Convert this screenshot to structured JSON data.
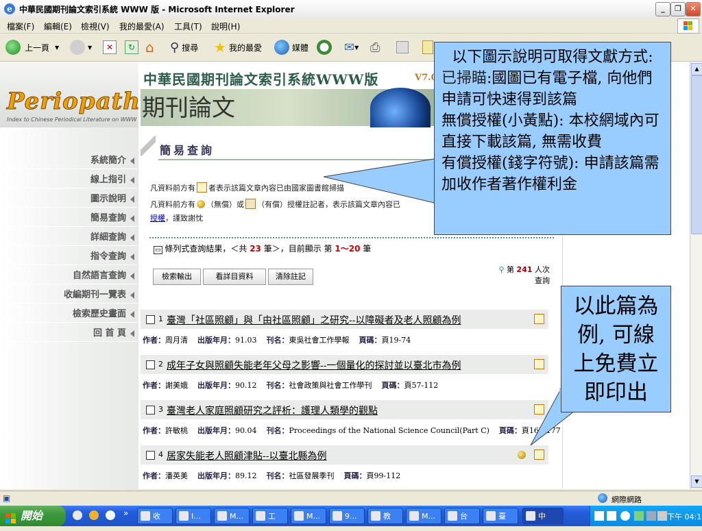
{
  "window": {
    "title": "中華民國期刊論文索引系統 WWW 版 - Microsoft Internet Explorer"
  },
  "menu": [
    "檔案(F)",
    "編輯(E)",
    "檢視(V)",
    "我的最愛(A)",
    "工具(T)",
    "說明(H)"
  ],
  "toolbar": {
    "back": "上一頁",
    "search": "搜尋",
    "favorites": "我的最愛",
    "media": "媒體"
  },
  "sidebar": {
    "logo": "Periopath",
    "logo_sub": "Index to Chinese Periodical Literature on WWW",
    "items": [
      "系統簡介",
      "線上指引",
      "圖示說明",
      "簡易查詢",
      "詳細查詢",
      "指令查詢",
      "自然語言查詢",
      "收編期刊一覽表",
      "檢索歷史畫面",
      "回 首 頁"
    ]
  },
  "banner": {
    "title": "中華民國期刊論文索引系統WWW版",
    "version": "V7.0",
    "calligraphy": "期刊論文"
  },
  "section": {
    "title": "簡易查詢"
  },
  "notes": {
    "line1_a": "凡資料前方有",
    "line1_b": "者表示該篇文章內容已由國家圖書館掃描",
    "line2_a": "凡資料前方有",
    "line2_b": "（無償）或",
    "line2_c": "（有償）授權註記者，表示該篇文章內容已",
    "line3_link": "授權",
    "line3_b": "，謹致謝忱"
  },
  "summary": {
    "a": "條列式查詢結果，＜共",
    "total": "23",
    "b": "筆＞，目前顯示 第",
    "range": "1～20",
    "c": "筆"
  },
  "buttons": {
    "export": "檢索輸出",
    "view": "看詳目資料",
    "clear": "清除註記"
  },
  "view_count": {
    "a": "第",
    "n": "241",
    "b": "人次",
    "c": "查詢"
  },
  "labels": {
    "author": "作者：",
    "date": "出版年月：",
    "journal": "刊名：",
    "pages": "頁碼："
  },
  "results": [
    {
      "num": "1",
      "title": "臺灣「社區照顧」與「由社區照顧」之研究--以障礙者及老人照顧為例",
      "author": "周月清",
      "date": "91.03",
      "journal": "東吳社會工作學報",
      "pages": "頁19-74"
    },
    {
      "num": "2",
      "title": "成年子女與照顧失能老年父母之影響--一個量化的探討並以臺北市為例",
      "author": "謝美娥",
      "date": "90.12",
      "journal": "社會政策與社會工作學刊",
      "pages": "頁57-112"
    },
    {
      "num": "3",
      "title": "臺灣老人家庭照顧研究之評析：護理人類學的觀點",
      "author": "許敏桃",
      "date": "90.04",
      "journal": "Proceedings of the National Science Council(Part C)",
      "pages": "頁167-177"
    },
    {
      "num": "4",
      "title": "居家失能老人照顧津貼--以臺北縣為例",
      "author": "潘英美",
      "date": "89.12",
      "journal": "社區發展季刊",
      "pages": "頁99-112"
    }
  ],
  "callout1": {
    "line0": "以下圖示說明可取得文獻方式:",
    "a_label": "已掃瞄",
    "a_text": ":國圖已有電子檔, 向他們申請可快速得到該篇",
    "b_label": "無償授權(小黃點)",
    "b_text": ": 本校網域內可直接下載該篇, 無需收費",
    "c_label": "有償授權(錢字符號)",
    "c_text": ": 申請該篇需加收作者著作權利金"
  },
  "callout2": {
    "text": "以此篇為例, 可線上免費立即印出"
  },
  "status": {
    "zone": "網際網路"
  },
  "taskbar": {
    "start": "開始",
    "tasks": [
      "收",
      "I...",
      "M...",
      "工",
      "M...",
      "9...",
      "教",
      "M...",
      "台",
      "臺",
      "中"
    ],
    "clock": "下午 04:18"
  },
  "colors": {
    "callout_fill": "#99ccff",
    "accent_red": "#cc0000",
    "nav_text": "#555555"
  }
}
